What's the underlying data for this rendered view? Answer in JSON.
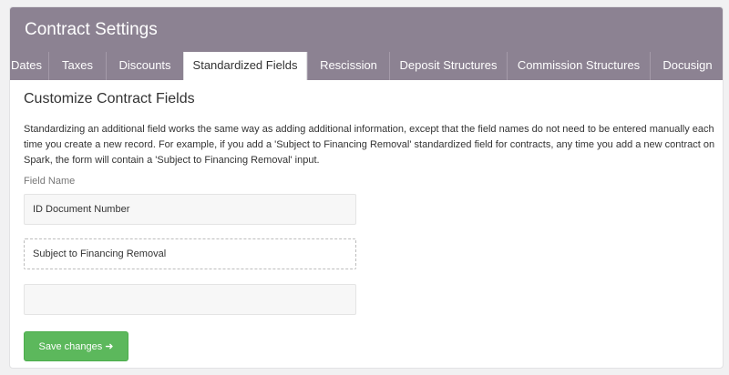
{
  "header": {
    "title": "Contract Settings"
  },
  "tabs": [
    {
      "label": "Dates"
    },
    {
      "label": "Taxes"
    },
    {
      "label": "Discounts"
    },
    {
      "label": "Standardized Fields"
    },
    {
      "label": "Rescission"
    },
    {
      "label": "Deposit Structures"
    },
    {
      "label": "Commission Structures"
    },
    {
      "label": "Docusign"
    }
  ],
  "active_tab": "Standardized Fields",
  "main": {
    "section_title": "Customize Contract Fields",
    "help_text": "Standardizing an additional field works the same way as adding additional information, except that the field names do not need to be entered manually each time you create a new record. For example, if you add a 'Subject to Financing Removal' standardized field for contracts, any time you add a new contract on Spark, the form will contain a 'Subject to Financing Removal' input.",
    "field_label": "Field Name",
    "fields": [
      {
        "value": "ID Document Number"
      },
      {
        "value": "Subject to Financing Removal"
      },
      {
        "value": ""
      }
    ],
    "save_label": "Save changes",
    "save_icon": "arrow-right-icon"
  },
  "colors": {
    "header_bg": "#8c8292",
    "save_button": "#5cb85c"
  }
}
